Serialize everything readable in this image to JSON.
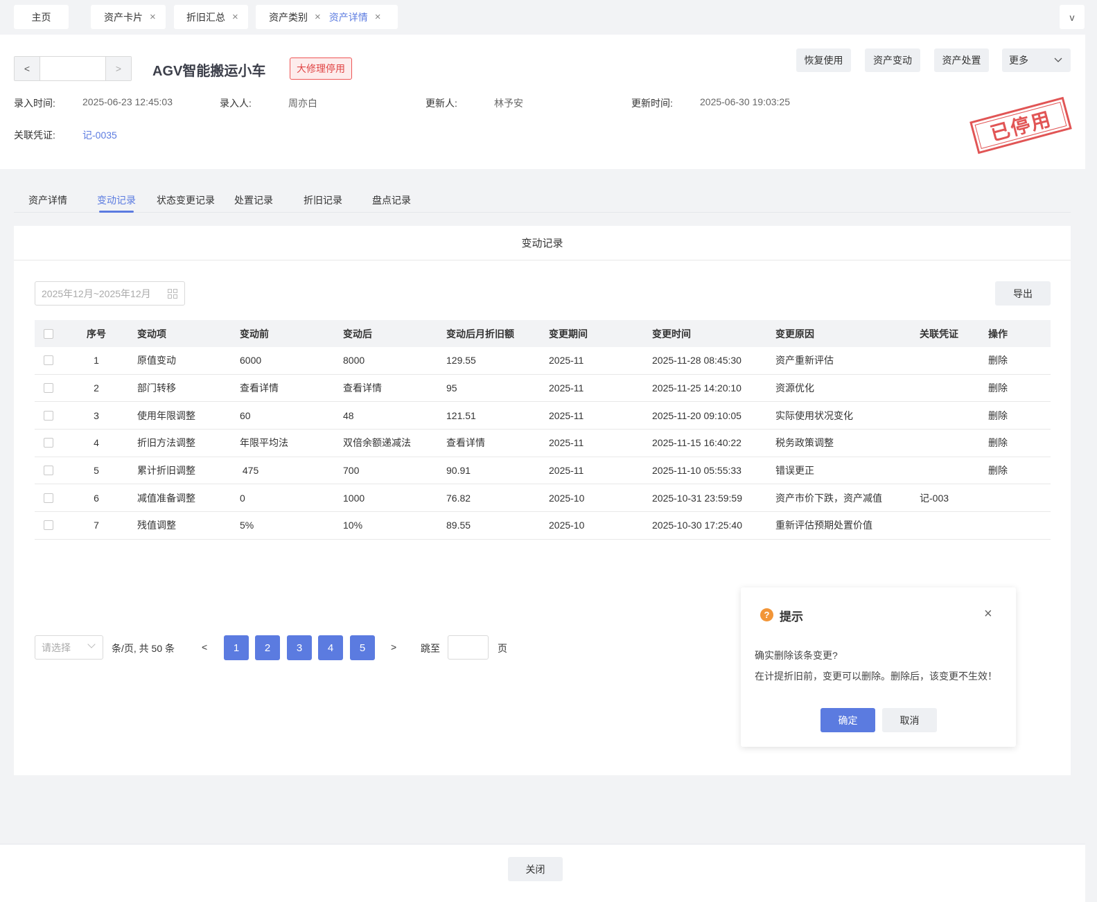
{
  "tabs": {
    "home": "主页",
    "items": [
      {
        "label": "资产卡片"
      },
      {
        "label": "折旧汇总"
      },
      {
        "label": "资产类别"
      },
      {
        "label": "资产详情"
      }
    ],
    "more": "v",
    "close_icon": "×"
  },
  "header": {
    "prev": "<",
    "next": ">",
    "title": "AGV智能搬运小车",
    "status_tag": "大修理停用",
    "buttons": {
      "restore": "恢复使用",
      "change": "资产变动",
      "dispose": "资产处置",
      "more": "更多"
    },
    "meta": {
      "entry_time_label": "录入时间:",
      "entry_time": "2025-06-23 12:45:03",
      "entry_user_label": "录入人:",
      "entry_user": "周亦白",
      "updater_label": "更新人:",
      "updater": "林予安",
      "update_time_label": "更新时间:",
      "update_time": "2025-06-30 19:03:25",
      "voucher_label": "关联凭证:",
      "voucher": "记-0035"
    },
    "stamp": "已停用"
  },
  "subtabs": {
    "detail": "资产详情",
    "change_log": "变动记录",
    "status_log": "状态变更记录",
    "dispose_log": "处置记录",
    "depr_log": "折旧记录",
    "inventory_log": "盘点记录"
  },
  "panel": {
    "title": "变动记录",
    "date_range_placeholder": "2025年12月~2025年12月",
    "export": "导出"
  },
  "table": {
    "headers": {
      "no": "序号",
      "item": "变动项",
      "before": "变动前",
      "after": "变动后",
      "dep": "变动后月折旧额",
      "period": "变更期间",
      "time": "变更时间",
      "reason": "变更原因",
      "voucher": "关联凭证",
      "op": "操作"
    },
    "rows": [
      {
        "no": "1",
        "item": "原值变动",
        "before": "6000",
        "after": "8000",
        "dep": "129.55",
        "period": "2025-11",
        "time": "2025-11-28 08:45:30",
        "reason": "资产重新评估",
        "voucher": "",
        "op": "删除"
      },
      {
        "no": "2",
        "item": "部门转移",
        "before": "查看详情",
        "after": "查看详情",
        "dep": "95",
        "period": "2025-11",
        "time": "2025-11-25 14:20:10",
        "reason": "资源优化",
        "voucher": "",
        "op": "删除"
      },
      {
        "no": "3",
        "item": "使用年限调整",
        "before": "60",
        "after": "48",
        "dep": "121.51",
        "period": "2025-11",
        "time": "2025-11-20 09:10:05",
        "reason": "实际使用状况变化",
        "voucher": "",
        "op": "删除"
      },
      {
        "no": "4",
        "item": "折旧方法调整",
        "before": "年限平均法",
        "after": "双倍余额递减法",
        "dep": "查看详情",
        "period": "2025-11",
        "time": "2025-11-15 16:40:22",
        "reason": "税务政策调整",
        "voucher": "",
        "op": "删除"
      },
      {
        "no": "5",
        "item": "累计折旧调整",
        "before": " 475",
        "after": "700",
        "dep": "90.91",
        "period": "2025-11",
        "time": "2025-11-10 05:55:33",
        "reason": "错误更正",
        "voucher": "",
        "op": "删除"
      },
      {
        "no": "6",
        "item": "减值准备调整",
        "before": "0",
        "after": "1000",
        "dep": "76.82",
        "period": "2025-10",
        "time": "2025-10-31 23:59:59",
        "reason": "资产市价下跌，资产减值",
        "voucher": "记-003",
        "op": ""
      },
      {
        "no": "7",
        "item": "残值调整",
        "before": "5%",
        "after": "10%",
        "dep": "89.55",
        "period": "2025-10",
        "time": "2025-10-30 17:25:40",
        "reason": "重新评估预期处置价值",
        "voucher": "",
        "op": ""
      }
    ]
  },
  "pagination": {
    "page_size_placeholder": "请选择",
    "summary": "条/页, 共 50 条",
    "prev": "<",
    "next": ">",
    "pages": [
      "1",
      "2",
      "3",
      "4",
      "5"
    ],
    "jump_label": "跳至",
    "page_unit": "页"
  },
  "dialog": {
    "icon": "?",
    "title": "提示",
    "close": "×",
    "message1": "确实删除该条变更?",
    "message2": "在计提折旧前，变更可以删除。删除后，该变更不生效！",
    "ok": "确定",
    "cancel": "取消"
  },
  "footer": {
    "close": "关闭"
  },
  "colors": {
    "accent": "#5b7be0",
    "danger": "#e04545",
    "warning": "#f29537"
  }
}
